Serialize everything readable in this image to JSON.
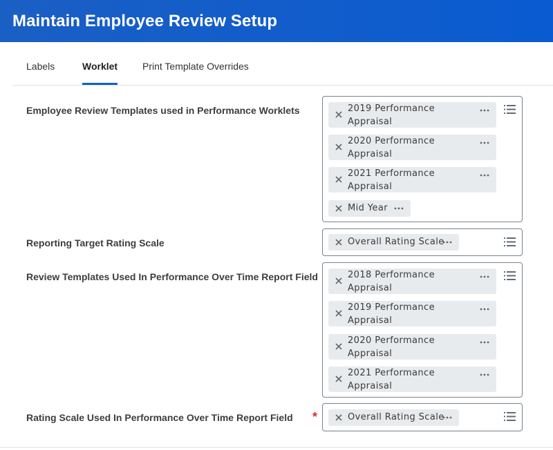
{
  "header": {
    "title": "Maintain Employee Review Setup"
  },
  "tabs": [
    {
      "label": "Labels",
      "active": false
    },
    {
      "label": "Worklet",
      "active": true
    },
    {
      "label": "Print Template Overrides",
      "active": false
    }
  ],
  "fields": {
    "review_templates": {
      "label": "Employee Review Templates used in Performance Worklets",
      "items": [
        {
          "line1": "2019 Performance",
          "line2": "Appraisal"
        },
        {
          "line1": "2020 Performance",
          "line2": "Appraisal"
        },
        {
          "line1": "2021 Performance",
          "line2": "Appraisal"
        },
        {
          "line1": "Mid Year",
          "line2": ""
        }
      ]
    },
    "target_rating_scale": {
      "label": "Reporting Target Rating Scale",
      "items": [
        {
          "line1": "Overall Rating Scale",
          "line2": ""
        }
      ]
    },
    "report_templates": {
      "label": "Review Templates Used In Performance Over Time Report Field",
      "items": [
        {
          "line1": "2018 Performance",
          "line2": "Appraisal"
        },
        {
          "line1": "2019 Performance",
          "line2": "Appraisal"
        },
        {
          "line1": "2020 Performance",
          "line2": "Appraisal"
        },
        {
          "line1": "2021 Performance",
          "line2": "Appraisal"
        }
      ]
    },
    "report_rating_scale": {
      "label": "Rating Scale Used In Performance Over Time Report Field",
      "required_marker": "*",
      "items": [
        {
          "line1": "Overall Rating Scale",
          "line2": ""
        }
      ]
    }
  },
  "icons": {
    "remove": "close-icon",
    "more": "more-options-icon",
    "prompt": "list-prompt-icon"
  },
  "colors": {
    "header_bg": "#0a5bd1",
    "tab_underline": "#0b63ce",
    "pill_bg": "#e8ebed",
    "required": "#de2b2b"
  }
}
